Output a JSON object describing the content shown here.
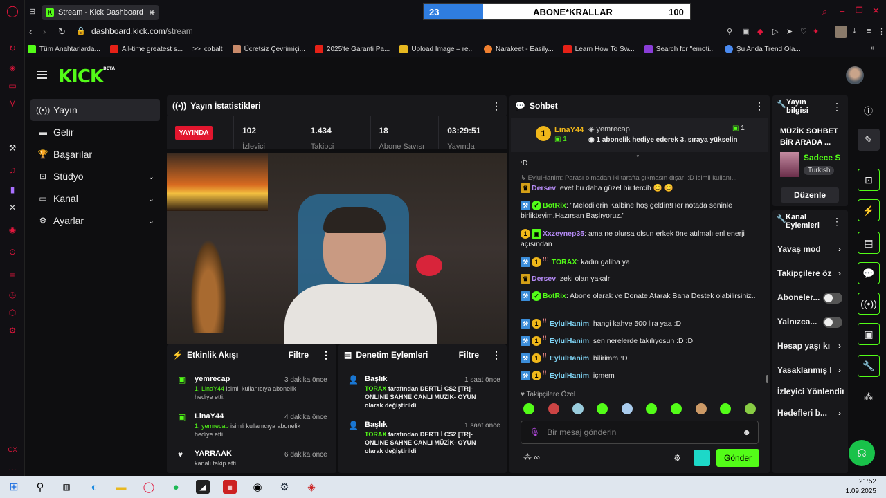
{
  "browser": {
    "tab_title": "Stream - Kick Dashboard",
    "url_host": "dashboard.kick.com",
    "url_path": "/stream",
    "bookmarks": [
      "Tüm Anahtarlarda...",
      "All-time greatest s...",
      "cobalt",
      "Ücretsiz Çevrimiçi...",
      "2025'te Garanti Pa...",
      "Upload Image – re...",
      "Narakeet - Easily...",
      "Learn How To Sw...",
      "Search for \"emoti...",
      "Şu Anda Trend Ola..."
    ]
  },
  "overlay": {
    "count": "23",
    "title": "ABONE*KRALLAR",
    "max": "100"
  },
  "kick": {
    "logo": "KICK",
    "logo_beta": "BETA",
    "nav": [
      {
        "label": "Yayın"
      },
      {
        "label": "Gelir"
      },
      {
        "label": "Başarılar"
      },
      {
        "label": "Stüdyo"
      },
      {
        "label": "Kanal"
      },
      {
        "label": "Ayarlar"
      }
    ],
    "stats_panel": {
      "title": "Yayın İstatistikleri",
      "live": "YAYINDA",
      "stats": [
        {
          "value": "102",
          "label": "İzleyici"
        },
        {
          "value": "1.434",
          "label": "Takipçi"
        },
        {
          "value": "18",
          "label": "Abone Sayısı"
        },
        {
          "value": "03:29:51",
          "label": "Yayında"
        }
      ]
    },
    "activity": {
      "title": "Etkinlik Akışı",
      "filter": "Filtre",
      "items": [
        {
          "name": "yemrecap",
          "time": "3 dakika önce",
          "prefix": "1, LinaY44",
          "text": " isimli kullanıcıya abonelik hediye etti."
        },
        {
          "name": "LinaY44",
          "time": "4 dakika önce",
          "prefix": "1, yemrecap",
          "text": " isimli kullanıcıya abonelik hediye etti."
        },
        {
          "name": "YARRAAK",
          "time": "6 dakika önce",
          "prefix": "",
          "text": "kanalı takip etti"
        }
      ]
    },
    "moderation": {
      "title": "Denetim Eylemleri",
      "filter": "Filtre",
      "items": [
        {
          "title": "Başlık",
          "time": "1 saat önce",
          "who": "TORAX",
          "text": " tarafından DERTLİ CS2 [TR]- ONLINE SAHNE CANLI MÜZİK- OYUN olarak değiştirildi"
        },
        {
          "title": "Başlık",
          "time": "1 saat önce",
          "who": "TORAX",
          "text": " tarafından DERTLİ CS2 [TR]- ONLINE SAHNE CANLI MÜZİK- OYUN olarak değiştirildi"
        }
      ]
    },
    "chat": {
      "title": "Sohbet",
      "pinned": {
        "user1": "LinaY44",
        "user1_count": "1",
        "user2": "yemrecap",
        "count": "1",
        "text": "1 abonelik hediye ederek 3. sıraya yükselin"
      },
      "messages": [
        {
          "user": "",
          "text": ":D"
        },
        {
          "user": "EylulHanim",
          "text": "Parası olmadan iki tarafta çıkmasın dışarı :D isimli kullanı..."
        },
        {
          "user": "Dersev",
          "text": "evet bu daha güzel bir tercih 😊 😊"
        },
        {
          "user": "BotRix",
          "text": "\"Melodilerin Kalbine hoş geldin!Her notada seninle birlikteyim.Hazırsan Başlıyoruz.\""
        },
        {
          "user": "Xxzeynep35",
          "text": "ama ne olursa olsun erkek öne atılmalı enl enerji açısından"
        },
        {
          "user": "TORAX",
          "text": "kadın galiba ya"
        },
        {
          "user": "Dersev",
          "text": "zeki olan yakalr"
        },
        {
          "user": "BotRix",
          "text": "Abone olarak ve Donate Atarak Bana Destek olabilirsiniz.."
        },
        {
          "user": "EylulHanim",
          "text": "hangi kahve 500 lira yaa :D"
        },
        {
          "user": "EylulHanim",
          "text": "sen nerelerde takılıyosun :D :D"
        },
        {
          "user": "EylulHanim",
          "text": "bilirimm :D"
        },
        {
          "user": "EylulHanim",
          "text": "içmem"
        }
      ],
      "followers_only": "Takipçilere Özel",
      "placeholder": "Bir mesaj gönderin",
      "send": "Gönder"
    },
    "stream_info": {
      "title": "Yayın bilgisi",
      "stream_title": "MÜZİK SOHBET BİR ARADA ...",
      "category": "Sadece S",
      "language": "Turkish",
      "edit": "Düzenle"
    },
    "channel_actions": {
      "title": "Kanal Eylemleri",
      "items": [
        "Yavaş mod",
        "Takipçilere öz",
        "Aboneler...",
        "Yalnızca...",
        "Hesap yaşı kı",
        "Yasaklanmış l",
        "İzleyici Yönlendir",
        "Hedefleri b..."
      ]
    }
  },
  "taskbar": {
    "time": "21:52",
    "date": "1.09.2025"
  }
}
